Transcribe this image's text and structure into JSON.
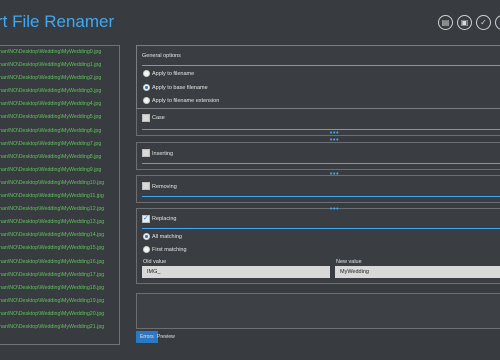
{
  "app": {
    "title": "rt File Renamer"
  },
  "toolbar": {
    "folder_icon": "folder-icon",
    "save_icon": "save-icon",
    "apply_icon": "check-icon",
    "close_icon": "close-icon"
  },
  "files": [
    "nan\\NO\\Desktop\\Wedding\\MyWedding0.jpg",
    "nan\\NO\\Desktop\\Wedding\\MyWedding1.jpg",
    "nan\\NO\\Desktop\\Wedding\\MyWedding2.jpg",
    "nan\\NO\\Desktop\\Wedding\\MyWedding3.jpg",
    "nan\\NO\\Desktop\\Wedding\\MyWedding4.jpg",
    "nan\\NO\\Desktop\\Wedding\\MyWedding5.jpg",
    "nan\\NO\\Desktop\\Wedding\\MyWedding6.jpg",
    "nan\\NO\\Desktop\\Wedding\\MyWedding7.jpg",
    "nan\\NO\\Desktop\\Wedding\\MyWedding8.jpg",
    "nan\\NO\\Desktop\\Wedding\\MyWedding9.jpg",
    "nan\\NO\\Desktop\\Wedding\\MyWedding10.jpg",
    "nan\\NO\\Desktop\\Wedding\\MyWedding11.jpg",
    "nan\\NO\\Desktop\\Wedding\\MyWedding12.jpg",
    "nan\\NO\\Desktop\\Wedding\\MyWedding13.jpg",
    "nan\\NO\\Desktop\\Wedding\\MyWedding14.jpg",
    "nan\\NO\\Desktop\\Wedding\\MyWedding15.jpg",
    "nan\\NO\\Desktop\\Wedding\\MyWedding16.jpg",
    "nan\\NO\\Desktop\\Wedding\\MyWedding17.jpg",
    "nan\\NO\\Desktop\\Wedding\\MyWedding18.jpg",
    "nan\\NO\\Desktop\\Wedding\\MyWedding19.jpg",
    "nan\\NO\\Desktop\\Wedding\\MyWedding20.jpg",
    "nan\\NO\\Desktop\\Wedding\\MyWedding21.jpg"
  ],
  "general": {
    "title": "General options",
    "options": [
      "Apply to filename",
      "Apply to base filename",
      "Apply to filename extension"
    ],
    "selected": 1
  },
  "case_section": {
    "label": "Case",
    "checked": false
  },
  "inserting": {
    "label": "Inserting",
    "checked": false
  },
  "removing": {
    "label": "Removing",
    "checked": false
  },
  "replacing": {
    "label": "Replacing",
    "checked": true,
    "modes": [
      "All matching",
      "First matching"
    ],
    "selected_mode": 0,
    "old_label": "Old value",
    "old_value": "IMG_",
    "new_label": "New value",
    "new_value": "MyWedding"
  },
  "expander_glyph": "•••",
  "tabs": [
    "Errors",
    "Preview"
  ],
  "active_tab": 0,
  "colors": {
    "accent": "#3fa9f5",
    "file_text": "#5fc35a",
    "background": "#383c40"
  }
}
